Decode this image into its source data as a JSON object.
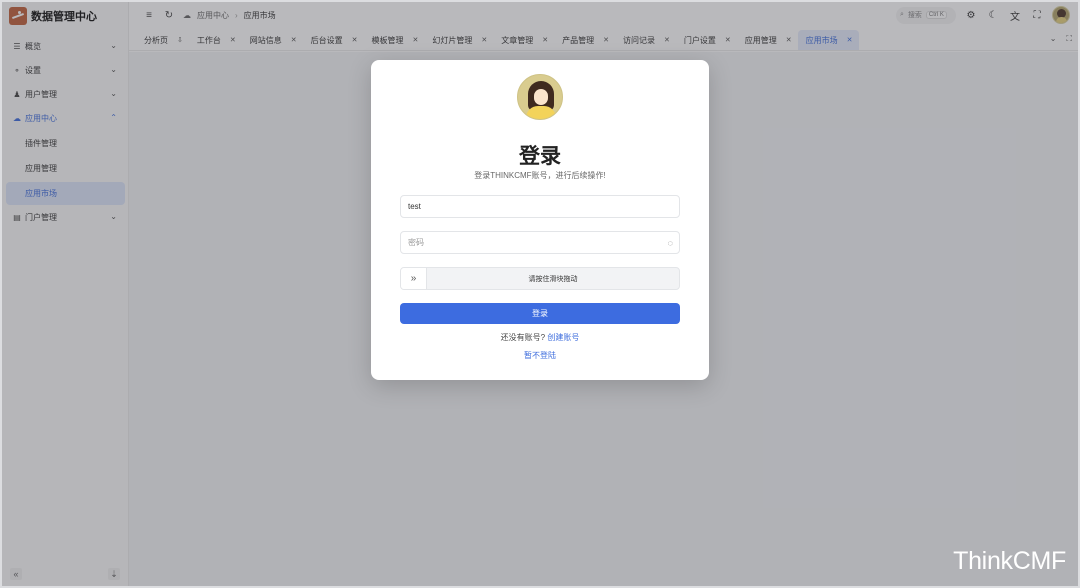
{
  "brand": {
    "title": "数据管理中心"
  },
  "sidebar": {
    "items": [
      {
        "label": "概览",
        "icon": "menu-lines-icon"
      },
      {
        "label": "设置",
        "icon": "nodes-icon"
      },
      {
        "label": "用户管理",
        "icon": "users-icon"
      },
      {
        "label": "应用中心",
        "icon": "cloud-icon"
      },
      {
        "label": "门户管理",
        "icon": "document-icon"
      }
    ],
    "app_center_children": [
      {
        "label": "插件管理"
      },
      {
        "label": "应用管理"
      },
      {
        "label": "应用市场"
      }
    ]
  },
  "header": {
    "breadcrumb": {
      "parent": "应用中心",
      "current": "应用市场"
    },
    "search": {
      "placeholder": "搜索",
      "shortcut": "Ctrl K"
    }
  },
  "tabs": [
    {
      "label": "分析页"
    },
    {
      "label": "工作台"
    },
    {
      "label": "网站信息"
    },
    {
      "label": "后台设置"
    },
    {
      "label": "模板管理"
    },
    {
      "label": "幻灯片管理"
    },
    {
      "label": "文章管理"
    },
    {
      "label": "产品管理"
    },
    {
      "label": "访问记录"
    },
    {
      "label": "门户设置"
    },
    {
      "label": "应用管理"
    },
    {
      "label": "应用市场"
    }
  ],
  "login": {
    "title": "登录",
    "subtitle": "登录THINKCMF账号，进行后续操作!",
    "username_value": "test",
    "password_placeholder": "密码",
    "slider_text": "请按住滑块拖动",
    "submit_label": "登录",
    "register_prompt": "还没有账号?",
    "register_link": "创建账号",
    "skip_link": "暂不登陆"
  },
  "watermark": "ThinkCMF",
  "colors": {
    "accent": "#3d6ce0",
    "overlay": "#3c3e46"
  }
}
